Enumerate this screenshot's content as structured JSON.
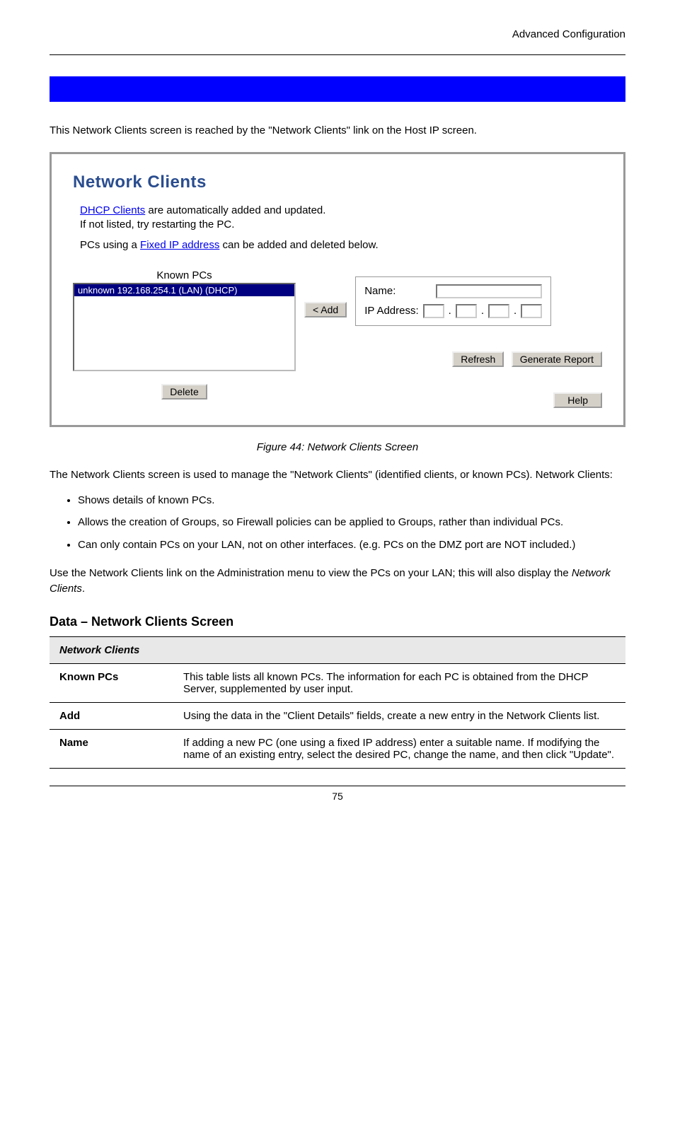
{
  "header_right": "Advanced Configuration",
  "section_title": "Network Clients",
  "intro": "This Network Clients screen is reached by the \"Network Clients\" link on the Host IP screen.",
  "panel": {
    "title": "Network Clients",
    "line1_link": "DHCP Clients",
    "line1_rest": " are automatically added and updated.",
    "line2": "If not listed, try restarting the PC.",
    "line3_pre": "PCs using a ",
    "line3_link": "Fixed IP address",
    "line3_post": " can be added and deleted below.",
    "known_label": "Known PCs",
    "list_item": "unknown 192.168.254.1 (LAN) (DHCP)",
    "add_btn": "< Add",
    "name_label": "Name:",
    "ip_label": "IP Address:",
    "delete_btn": "Delete",
    "refresh_btn": "Refresh",
    "report_btn": "Generate Report",
    "help_btn": "Help"
  },
  "figure_caption": "Figure 44: Network Clients Screen",
  "para1": "The Network Clients screen is used to manage the \"Network Clients\" (identified clients, or known PCs). Network Clients:",
  "bullets": [
    "Shows details of known PCs.",
    "Allows the creation of Groups, so Firewall policies can be applied to Groups, rather than individual PCs.",
    " Can only contain PCs on your LAN, not on other interfaces. (e.g. PCs on the DMZ port are NOT included.)"
  ],
  "para2_pre": "Use the Network Clients link on the Administration menu to view the PCs on your LAN; this will also display the ",
  "para2_em": "Network Clients",
  "para2_post": ".",
  "data_heading": "Data – Network Clients Screen",
  "table_group": "Network Clients",
  "rows": [
    {
      "label": "Known PCs",
      "text": "This table lists all known PCs. The information for each PC is obtained from the DHCP Server, supplemented by user input."
    },
    {
      "label": "Add",
      "text": "Using the data in the \"Client Details\" fields, create a new entry in the Network Clients list."
    },
    {
      "label": "Name",
      "text": "If adding a new PC (one using a fixed IP address) enter a suitable name. If modifying the name of an existing entry, select the desired PC, change the name, and then click \"Update\"."
    }
  ],
  "page_number": "75"
}
